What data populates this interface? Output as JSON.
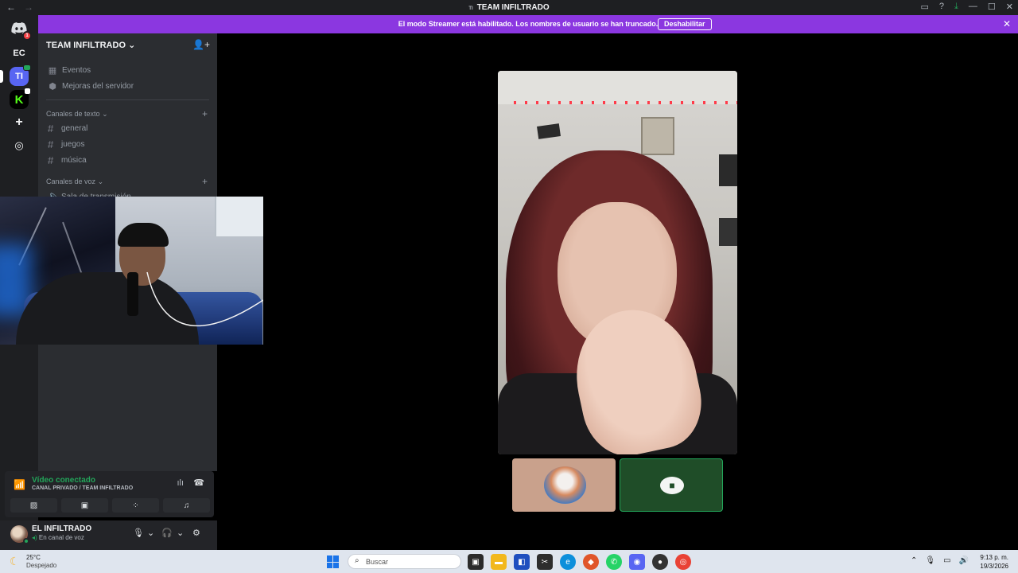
{
  "window": {
    "title": "TEAM INFILTRADO",
    "server_short": "TI",
    "back_glyph": "←",
    "forward_glyph": "→",
    "controls": [
      "▭",
      "?",
      "⤓",
      "—",
      "☐",
      "✕"
    ]
  },
  "banner": {
    "message": "El modo Streamer está habilitado. Los nombres de usuario se han truncado.",
    "button": "Deshabilitar",
    "close": "✕"
  },
  "rail": {
    "home_badge": "1",
    "servers": [
      {
        "label": "EC"
      },
      {
        "label": "TI"
      },
      {
        "label": "K"
      }
    ],
    "add_glyph": "+",
    "explore_glyph": "◎"
  },
  "sidebar": {
    "server_name": "TEAM INFILTRADO",
    "server_chevron": "⌄",
    "items": [
      {
        "icon": "▦",
        "label": "Eventos"
      },
      {
        "icon": "⬢",
        "label": "Mejoras del servidor"
      }
    ],
    "text_category": "Canales de texto",
    "text_channels": [
      "general",
      "juegos",
      "música"
    ],
    "voice_category": "Canales de voz",
    "voice_channels": [
      "Sala de transmisión"
    ],
    "plus": "+"
  },
  "voice_panel": {
    "status": "Vídeo conectado",
    "location": "CANAL PRIVADO / TEAM INFILTRADO"
  },
  "user_panel": {
    "name": "EL INFILTRADO",
    "status": "En canal de voz"
  },
  "taskbar": {
    "temperature": "25°C",
    "weather": "Despejado",
    "search_placeholder": "Buscar",
    "time": "9:13 p. m.",
    "date": "19/3/2026"
  },
  "colors": {
    "banner": "#8b37e0",
    "connected": "#23a55a",
    "brand": "#5865f2"
  }
}
